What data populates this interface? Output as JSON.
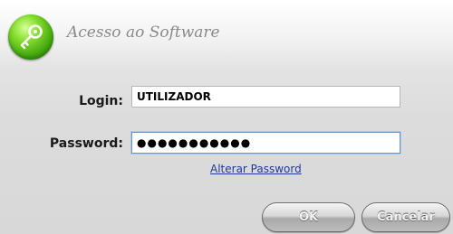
{
  "dialog": {
    "title": "Acesso ao Software",
    "logo_icon": "key-icon",
    "accent_color": "#3fa10c"
  },
  "login": {
    "label": "Login:",
    "value": "UTILIZADOR"
  },
  "password": {
    "label": "Password:",
    "value": "●●●●●●●●●●●"
  },
  "links": {
    "change_password": "Alterar Password"
  },
  "buttons": {
    "ok_label": "OK",
    "cancel_label": "Cancelar"
  }
}
